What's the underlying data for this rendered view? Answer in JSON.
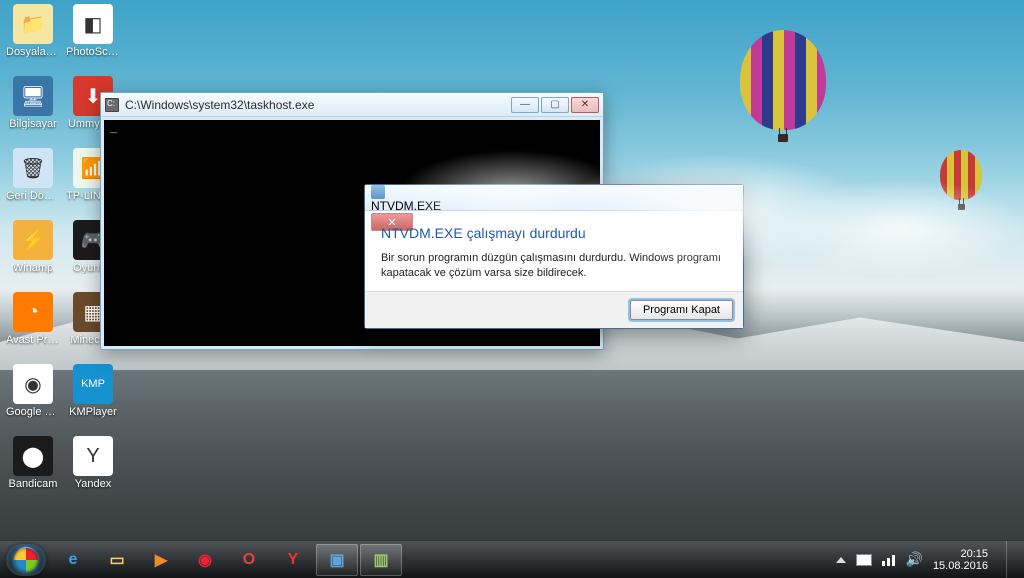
{
  "desktop_icons": [
    [
      {
        "label": "Dosyalarım",
        "icon": "📁",
        "bg": "#f5e7a1"
      },
      {
        "label": "PhotoScape",
        "icon": "◧",
        "bg": "#ffffff"
      }
    ],
    [
      {
        "label": "Bilgisayar",
        "icon": "🖥",
        "bg": "#3a75a8"
      },
      {
        "label": "UmmyV…",
        "icon": "⬇",
        "bg": "#d6392b"
      }
    ],
    [
      {
        "label": "Geri Dönüş…",
        "icon": "🗑",
        "bg": "#cfe4f4"
      },
      {
        "label": "TP-LIN Wireless",
        "icon": "📶",
        "bg": "#eef7ec"
      }
    ],
    [
      {
        "label": "Winamp",
        "icon": "⚡",
        "bg": "#f4b13d"
      },
      {
        "label": "Oyunl…",
        "icon": "🎮",
        "bg": "#1b1b1b"
      }
    ],
    [
      {
        "label": "Avast Premier",
        "icon": "◔",
        "bg": "#ff7a00"
      },
      {
        "label": "Minecraft",
        "icon": "▦",
        "bg": "#6b4a2b"
      }
    ],
    [
      {
        "label": "Google Chrome",
        "icon": "◉",
        "bg": "#ffffff"
      },
      {
        "label": "KMPlayer",
        "icon": "KMP",
        "bg": "#1692d1"
      }
    ],
    [
      {
        "label": "Bandicam",
        "icon": "⬤",
        "bg": "#1b1b1b"
      },
      {
        "label": "Yandex",
        "icon": "Y",
        "bg": "#ffffff"
      }
    ]
  ],
  "console": {
    "title": "C:\\Windows\\system32\\taskhost.exe",
    "prompt": "_",
    "buttons": {
      "min": "—",
      "max": "▢",
      "close": "✕"
    }
  },
  "dialog": {
    "title": "NTVDM.EXE",
    "heading": "NTVDM.EXE çalışmayı durdurdu",
    "body": "Bir sorun programın düzgün çalışmasını durdurdu. Windows programı kapatacak ve çözüm varsa size bildirecek.",
    "close_btn": "✕",
    "action": "Programı Kapat"
  },
  "taskbar": {
    "pins": [
      {
        "name": "ie",
        "glyph": "e",
        "color": "#3aa0e8"
      },
      {
        "name": "explorer",
        "glyph": "▭",
        "color": "#f3d06b"
      },
      {
        "name": "wmp",
        "glyph": "▶",
        "color": "#f08b2c"
      },
      {
        "name": "chrome",
        "glyph": "◉",
        "color": "#e23"
      },
      {
        "name": "opera",
        "glyph": "O",
        "color": "#e3433f"
      },
      {
        "name": "yandex",
        "glyph": "Y",
        "color": "#e33"
      },
      {
        "name": "task1",
        "glyph": "▣",
        "color": "#5aa6dd",
        "active": true
      },
      {
        "name": "task2",
        "glyph": "▥",
        "color": "#9ac86b",
        "active": true
      }
    ],
    "tray": {
      "time": "20:15",
      "date": "15.08.2016"
    }
  }
}
